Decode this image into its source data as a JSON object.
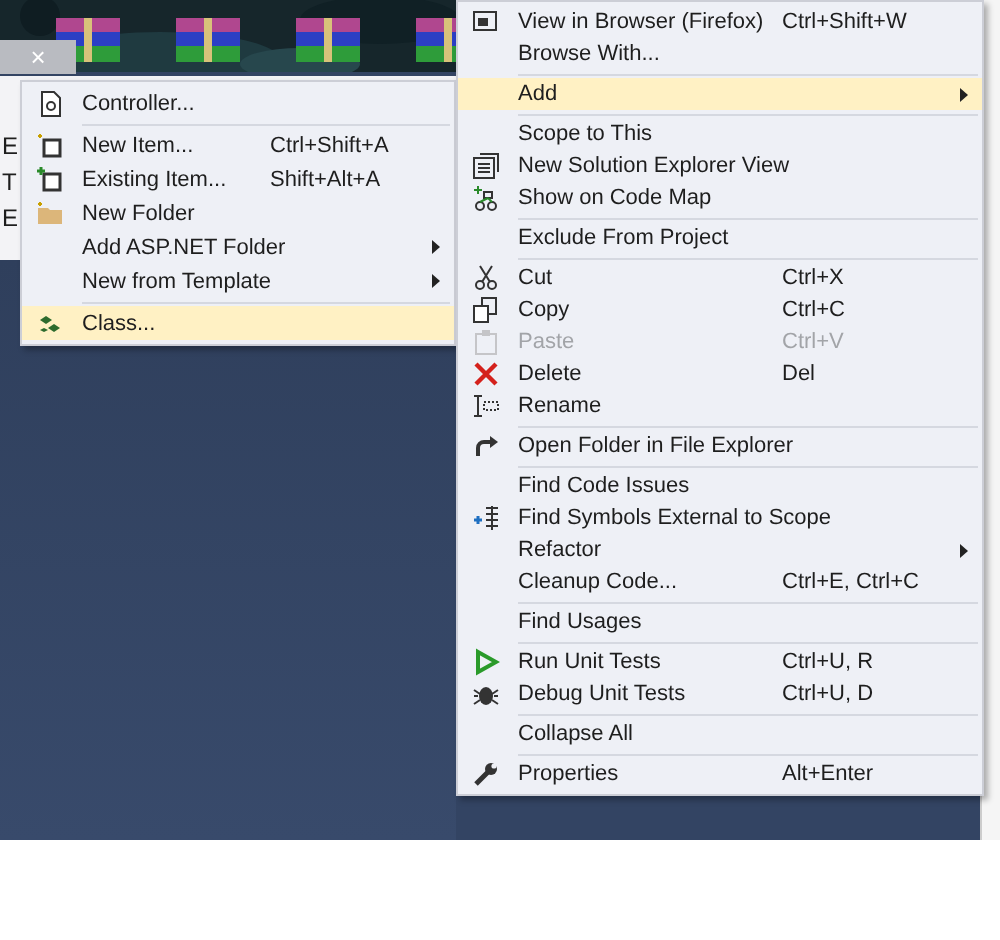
{
  "desktop": {
    "icons": [
      {
        "kind": "archive"
      },
      {
        "kind": "archive"
      },
      {
        "kind": "archive"
      },
      {
        "kind": "archive"
      }
    ]
  },
  "editor": {
    "tab_close": "×",
    "fragments": [
      "E",
      "T",
      "E"
    ]
  },
  "add_submenu": {
    "items": [
      {
        "kind": "item",
        "label": "Controller...",
        "selected": false,
        "disabled": false,
        "submenu": false
      },
      {
        "kind": "separator"
      },
      {
        "kind": "item",
        "label": "New Item...",
        "shortcut": "Ctrl+Shift+A",
        "selected": false,
        "disabled": false,
        "submenu": false
      },
      {
        "kind": "item",
        "label": "Existing Item...",
        "shortcut": "Shift+Alt+A",
        "selected": false,
        "disabled": false,
        "submenu": false
      },
      {
        "kind": "item",
        "label": "New Folder",
        "selected": false,
        "disabled": false,
        "submenu": false
      },
      {
        "kind": "item",
        "label": "Add ASP.NET Folder",
        "selected": false,
        "disabled": false,
        "submenu": true
      },
      {
        "kind": "item",
        "label": "New from Template",
        "selected": false,
        "disabled": false,
        "submenu": true
      },
      {
        "kind": "separator"
      },
      {
        "kind": "item",
        "label": "Class...",
        "selected": true,
        "disabled": false,
        "submenu": false
      }
    ]
  },
  "context_menu": {
    "items": [
      {
        "kind": "item",
        "label": "View in Browser (Firefox)",
        "shortcut": "Ctrl+Shift+W",
        "selected": false,
        "disabled": false,
        "submenu": false
      },
      {
        "kind": "item",
        "label": "Browse With...",
        "selected": false,
        "disabled": false,
        "submenu": false
      },
      {
        "kind": "separator"
      },
      {
        "kind": "item",
        "label": "Add",
        "selected": true,
        "disabled": false,
        "submenu": true
      },
      {
        "kind": "separator"
      },
      {
        "kind": "item",
        "label": "Scope to This",
        "selected": false,
        "disabled": false,
        "submenu": false
      },
      {
        "kind": "item",
        "label": "New Solution Explorer View",
        "selected": false,
        "disabled": false,
        "submenu": false
      },
      {
        "kind": "item",
        "label": "Show on Code Map",
        "selected": false,
        "disabled": false,
        "submenu": false
      },
      {
        "kind": "separator"
      },
      {
        "kind": "item",
        "label": "Exclude From Project",
        "selected": false,
        "disabled": false,
        "submenu": false
      },
      {
        "kind": "separator"
      },
      {
        "kind": "item",
        "label": "Cut",
        "shortcut": "Ctrl+X",
        "selected": false,
        "disabled": false,
        "submenu": false
      },
      {
        "kind": "item",
        "label": "Copy",
        "shortcut": "Ctrl+C",
        "selected": false,
        "disabled": false,
        "submenu": false
      },
      {
        "kind": "item",
        "label": "Paste",
        "shortcut": "Ctrl+V",
        "selected": false,
        "disabled": true,
        "submenu": false
      },
      {
        "kind": "item",
        "label": "Delete",
        "shortcut": "Del",
        "selected": false,
        "disabled": false,
        "submenu": false
      },
      {
        "kind": "item",
        "label": "Rename",
        "selected": false,
        "disabled": false,
        "submenu": false
      },
      {
        "kind": "separator"
      },
      {
        "kind": "item",
        "label": "Open Folder in File Explorer",
        "selected": false,
        "disabled": false,
        "submenu": false
      },
      {
        "kind": "separator"
      },
      {
        "kind": "item",
        "label": "Find Code Issues",
        "selected": false,
        "disabled": false,
        "submenu": false
      },
      {
        "kind": "item",
        "label": "Find Symbols External to Scope",
        "selected": false,
        "disabled": false,
        "submenu": false
      },
      {
        "kind": "item",
        "label": "Refactor",
        "selected": false,
        "disabled": false,
        "submenu": true
      },
      {
        "kind": "item",
        "label": "Cleanup Code...",
        "shortcut": "Ctrl+E, Ctrl+C",
        "selected": false,
        "disabled": false,
        "submenu": false
      },
      {
        "kind": "separator"
      },
      {
        "kind": "item",
        "label": "Find Usages",
        "selected": false,
        "disabled": false,
        "submenu": false
      },
      {
        "kind": "separator"
      },
      {
        "kind": "item",
        "label": "Run Unit Tests",
        "shortcut": "Ctrl+U, R",
        "selected": false,
        "disabled": false,
        "submenu": false
      },
      {
        "kind": "item",
        "label": "Debug Unit Tests",
        "shortcut": "Ctrl+U, D",
        "selected": false,
        "disabled": false,
        "submenu": false
      },
      {
        "kind": "separator"
      },
      {
        "kind": "item",
        "label": "Collapse All",
        "selected": false,
        "disabled": false,
        "submenu": false
      },
      {
        "kind": "separator"
      },
      {
        "kind": "item",
        "label": "Properties",
        "shortcut": "Alt+Enter",
        "selected": false,
        "disabled": false,
        "submenu": false
      }
    ]
  }
}
